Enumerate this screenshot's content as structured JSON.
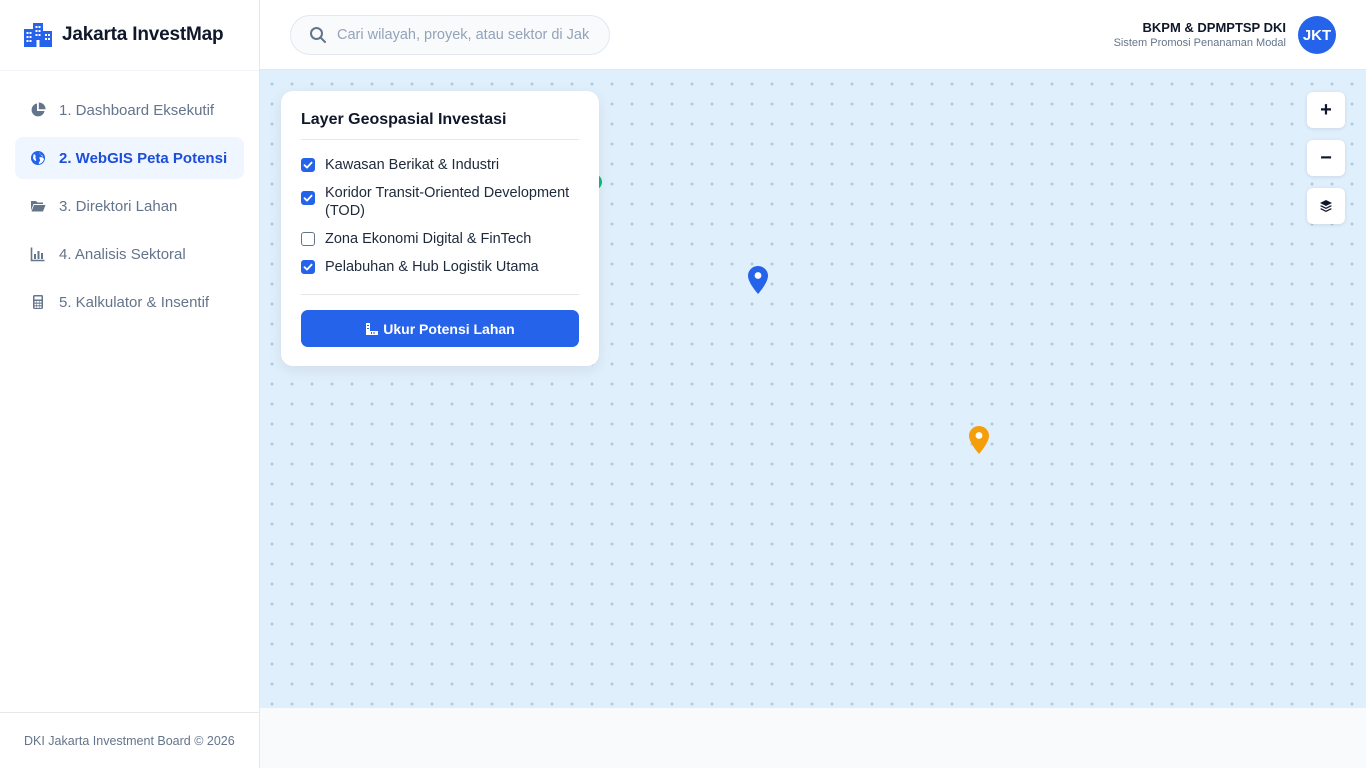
{
  "sidebar": {
    "brand": {
      "title": "Jakarta InvestMap",
      "icon": "city-buildings-icon"
    },
    "nav": [
      {
        "label": "1. Dashboard Eksekutif",
        "icon": "pie-chart-icon",
        "active": false
      },
      {
        "label": "2. WebGIS Peta Potensi",
        "icon": "globe-icon",
        "active": true
      },
      {
        "label": "3. Direktori Lahan",
        "icon": "folder-open-icon",
        "active": false
      },
      {
        "label": "4. Analisis Sektoral",
        "icon": "bar-chart-icon",
        "active": false
      },
      {
        "label": "5. Kalkulator & Insentif",
        "icon": "calculator-icon",
        "active": false
      }
    ],
    "footer": "DKI Jakarta Investment Board © 2026"
  },
  "header": {
    "search": {
      "placeholder": "Cari wilayah, proyek, atau sektor di Jakarta...",
      "value": ""
    },
    "org_name": "BKPM & DPMPTSP DKI",
    "org_subtitle": "Sistem Promosi Penanaman Modal",
    "avatar": "JKT"
  },
  "map": {
    "layer_panel": {
      "title": "Layer Geospasial Investasi",
      "layers": [
        {
          "label": "Kawasan Berikat & Industri",
          "checked": true
        },
        {
          "label": "Koridor Transit-Oriented Development (TOD)",
          "checked": true
        },
        {
          "label": "Zona Ekonomi Digital & FinTech",
          "checked": false
        },
        {
          "label": "Pelabuhan & Hub Logistik Utama",
          "checked": true
        }
      ],
      "action_label": "Ukur Potensi Lahan",
      "action_icon": "ruler-icon"
    },
    "controls": {
      "zoom_in": "+",
      "zoom_out": "−",
      "layers_icon": "layers-icon"
    },
    "markers": [
      {
        "color": "#2563eb",
        "icon": "map-pin-icon"
      },
      {
        "color": "#f59e0b",
        "icon": "map-pin-icon"
      }
    ]
  },
  "colors": {
    "accent": "#2563eb",
    "map_background": "#e0effc",
    "map_dots": "#a9cbe4",
    "marker_blue": "#2563eb",
    "marker_orange": "#f59e0b",
    "marker_green": "#10b981"
  }
}
